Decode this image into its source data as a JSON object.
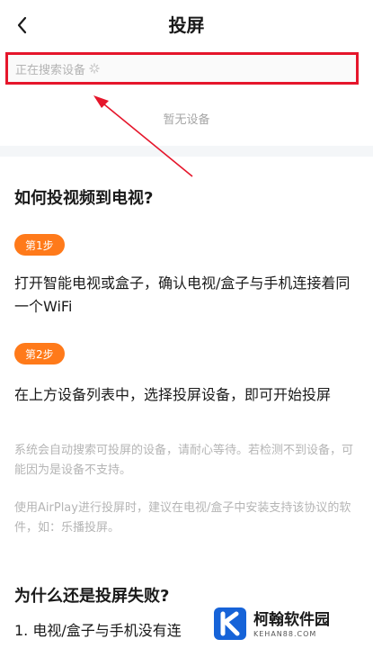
{
  "header": {
    "title": "投屏"
  },
  "search": {
    "status": "正在搜索设备",
    "empty": "暂无设备"
  },
  "guide": {
    "heading": "如何投视频到电视?",
    "steps": [
      {
        "badge": "第1步",
        "text": "打开智能电视或盒子，确认电视/盒子与手机连接着同一个WiFi"
      },
      {
        "badge": "第2步",
        "text": "在上方设备列表中，选择投屏设备，即可开始投屏"
      }
    ],
    "notes": [
      "系统会自动搜索可投屏的设备，请耐心等待。若检测不到设备，可能因为是设备不支持。",
      "使用AirPlay进行投屏时，建议在电视/盒子中安装支持该协议的软件，如：乐播投屏。"
    ]
  },
  "faq": {
    "heading": "为什么还是投屏失败?",
    "item1": "1. 电视/盒子与手机没有连"
  },
  "watermark": {
    "name": "柯翰软件园",
    "domain": "KEHAN88.COM"
  },
  "colors": {
    "accent": "#ff7a1a",
    "highlight": "#e5162b"
  }
}
